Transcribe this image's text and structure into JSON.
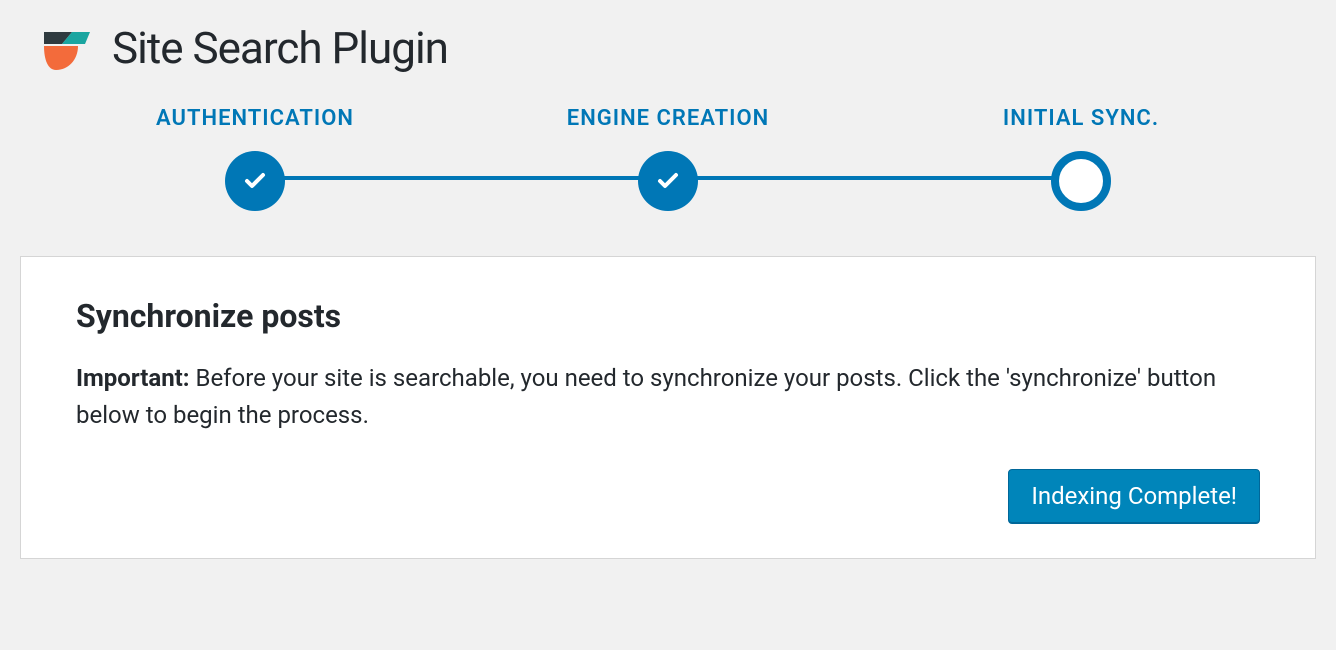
{
  "header": {
    "title": "Site Search Plugin"
  },
  "stepper": {
    "steps": [
      {
        "label": "AUTHENTICATION",
        "status": "done"
      },
      {
        "label": "ENGINE CREATION",
        "status": "done"
      },
      {
        "label": "INITIAL SYNC.",
        "status": "current"
      }
    ]
  },
  "panel": {
    "heading": "Synchronize posts",
    "important_label": "Important:",
    "body_text": "Before your site is searchable, you need to synchronize your posts. Click the 'synchronize' button below to begin the process.",
    "button_label": "Indexing Complete!"
  }
}
